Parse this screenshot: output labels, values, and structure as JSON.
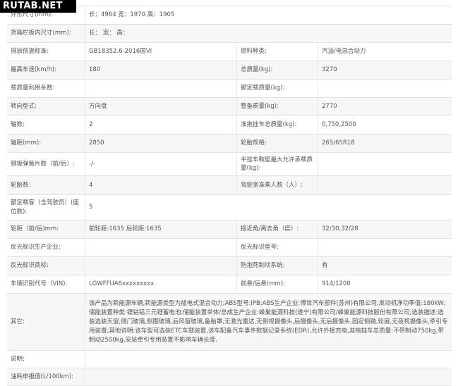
{
  "watermark": "RUTAB.NET",
  "rows": {
    "r1": {
      "label": "外形尺寸(mm):",
      "value": "长：4964 宽：1970 高：1905"
    },
    "r2": {
      "label": "货箱栏板内尺寸(mm):",
      "value": "长：  宽：  高："
    },
    "r3": {
      "label": "排放依据标准:",
      "value": "GB18352.6-2016国VI",
      "label2": "燃料种类:",
      "value2": "汽油/电混合动力"
    },
    "r4": {
      "label": "最高车速(km/h):",
      "value": "180",
      "label2": "总质量(kg):",
      "value2": "3270"
    },
    "r5": {
      "label": "载质量利用系数:",
      "value": "",
      "label2": "额定载质量(kg):",
      "value2": ""
    },
    "r6": {
      "label": "转向型式:",
      "value": "方向盘",
      "label2": "整备质量(kg):",
      "value2": "2770"
    },
    "r7": {
      "label": "轴数:",
      "value": "2",
      "label2": "准拖挂车总质量(kg):",
      "value2": "0,750,2500"
    },
    "r8": {
      "label": "轴距(mm):",
      "value": "2850",
      "label2": "轮胎规格:",
      "value2": "265/65R18"
    },
    "r9": {
      "label": "钢板弹簧片数（前/后）:",
      "value": "-/-",
      "label2": "半挂车鞍座最大允许承载质量(kg):",
      "value2": ""
    },
    "r10": {
      "label": "轮胎数:",
      "value": "4",
      "label2": "驾驶室准乘人数（人）:",
      "value2": ""
    },
    "r11": {
      "label": "额定载客（含驾驶员）(座位数):",
      "value": "5"
    },
    "r12": {
      "label": "轮距（前/后)mm:",
      "value": "前轮距:1635 后轮距:1635",
      "label2": "接近角/离去角（度）:",
      "value2": "32/30,32/28"
    },
    "r13": {
      "label": "反光标识生产企业:",
      "value": "",
      "label2": "反光标识型号:",
      "value2": ""
    },
    "r14": {
      "label": "反光标识商标:",
      "value": "",
      "label2": "防抱死制动系统:",
      "value2": "有"
    },
    "r15": {
      "label": "车辆识别代号（VIN):",
      "value": "LGWFFUA6xxxxxxxxx",
      "label2": "前悬/后悬(mm):",
      "value2": "914/1200"
    },
    "r16": {
      "label": "其它:",
      "value": "该产品为新能源车辆,新能源类型为插电式混合动力;ABS型号:IPB;ABS生产企业:博世汽车部件(苏州)有限公司;发动机净功率值:180kW;储能装置种类:镍钴锰三元锂蓄电池;储能装置单体/总成生产企业:蜂巢能源科技(遂宁)有限公司/蜂巢能源科技股份有限公司;选装描述:选装选装天窗,侧门玻璃,侧围玻璃,后风窗玻璃,备胎罩,无激光雷达,无侧视摄像头,后摄像头,无后摄像头,固定侧踏,轮眉,无夜视摄像头,牵引专用装置;其他说明:该车型可选装ETC车载装置,该车配备汽车事件数据记录系统(EDR),允许外接充电,准拖挂车总质量:不带制动750kg,带制动2500kg,安装牵引专用装置不影响车辆长度."
    },
    "r17": {
      "label": "说明:",
      "value": ""
    },
    "r18": {
      "label": "油耗申报值(L/100km):",
      "value": ""
    }
  }
}
